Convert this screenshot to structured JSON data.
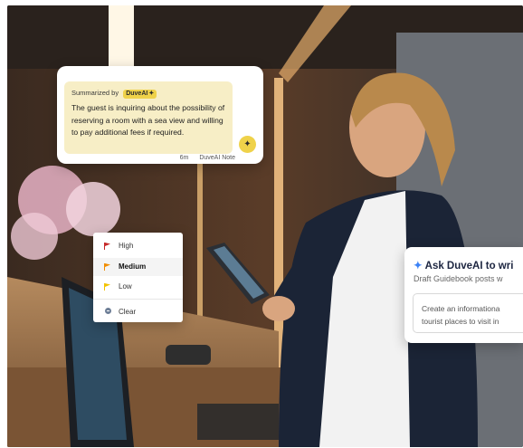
{
  "summary_note": {
    "summarized_by_label": "Summarized by",
    "source_chip": "DuveAI",
    "chip_icon": "sparkle-icon",
    "body_text": "The guest is inquiring about the possibility of reserving a room with a sea view and willing to pay additional fees if required.",
    "time_ago": "6m",
    "note_type": "DuveAI Note",
    "action_icon": "sparkle-icon",
    "accent_color": "#efd24a",
    "background_color": "#f7eec6"
  },
  "priority_menu": {
    "items": [
      {
        "label": "High",
        "flag_color": "#c62828",
        "icon": "flag-icon"
      },
      {
        "label": "Medium",
        "flag_color": "#f08c00",
        "icon": "flag-icon"
      },
      {
        "label": "Low",
        "flag_color": "#f2c200",
        "icon": "flag-icon"
      }
    ],
    "selected": "Medium",
    "clear_label": "Clear",
    "clear_icon": "minus-circle-icon"
  },
  "ask_duveai": {
    "title": "Ask DuveAI to wri",
    "subtitle": "Draft Guidebook posts w",
    "input_line1": "Create an informationa",
    "input_line2": "tourist places to visit in",
    "title_icon": "sparkle-icon",
    "icon_color": "#3b82f6"
  }
}
